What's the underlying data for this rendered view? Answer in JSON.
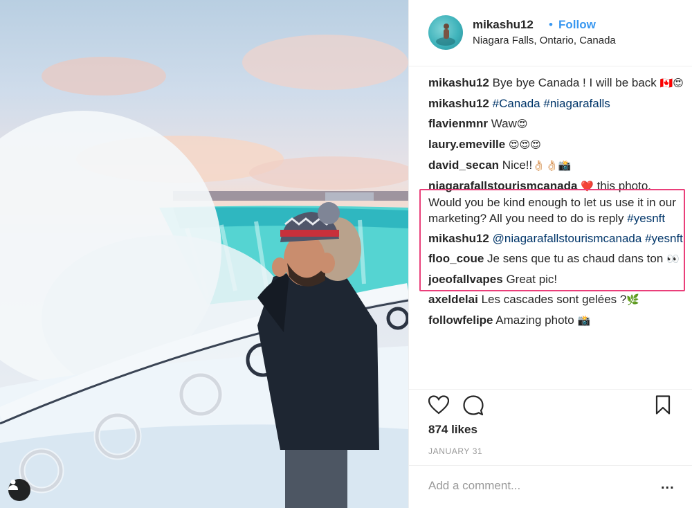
{
  "post": {
    "author": "mikashu12",
    "separator": "•",
    "follow_label": "Follow",
    "location": "Niagara Falls, Ontario, Canada"
  },
  "comments": [
    {
      "user": "mikashu12",
      "text": "Bye bye Canada ! I will be back ",
      "emoji": "🇨🇦😍"
    },
    {
      "user": "mikashu12",
      "tags": [
        "#Canada",
        "#niagarafalls"
      ]
    },
    {
      "user": "flavienmnr",
      "text": "Waw",
      "emoji": "😍"
    },
    {
      "user": "laury.emeville",
      "text": "",
      "emoji": "😍😍😍"
    },
    {
      "user": "david_secan",
      "text": "Nice!!",
      "emoji": "👌🏻👌🏻📸"
    },
    {
      "user": "niagarafallstourismcanada",
      "emoji": "❤️",
      "text": " this photo. Would you be kind enough to let us use it in our marketing? All you need to do is reply ",
      "tag": "#yesnft"
    },
    {
      "user": "mikashu12",
      "mention": "@niagarafallstourismcanada",
      "tag": "#yesnft"
    },
    {
      "user": "floo_coue",
      "text": "Je sens que tu as chaud dans ton ",
      "emoji": "👀"
    },
    {
      "user": "joeofallvapes",
      "text": "Great pic!"
    },
    {
      "user": "axeldelai",
      "text": "Les cascades sont gelées ?",
      "emoji": "🌿"
    },
    {
      "user": "followfelipe",
      "text": "Amazing photo ",
      "emoji": "📸"
    }
  ],
  "actions": {
    "like_icon": "heart-icon",
    "comment_icon": "speech-bubble-icon",
    "save_icon": "bookmark-icon"
  },
  "likes_label": "874 likes",
  "date_label": "JANUARY 31",
  "add_comment": {
    "placeholder": "Add a comment...",
    "more_label": "..."
  },
  "colors": {
    "link": "#003569",
    "follow": "#3897f0",
    "highlight": "#ea3f7a",
    "text": "#262626",
    "muted": "#999999"
  }
}
